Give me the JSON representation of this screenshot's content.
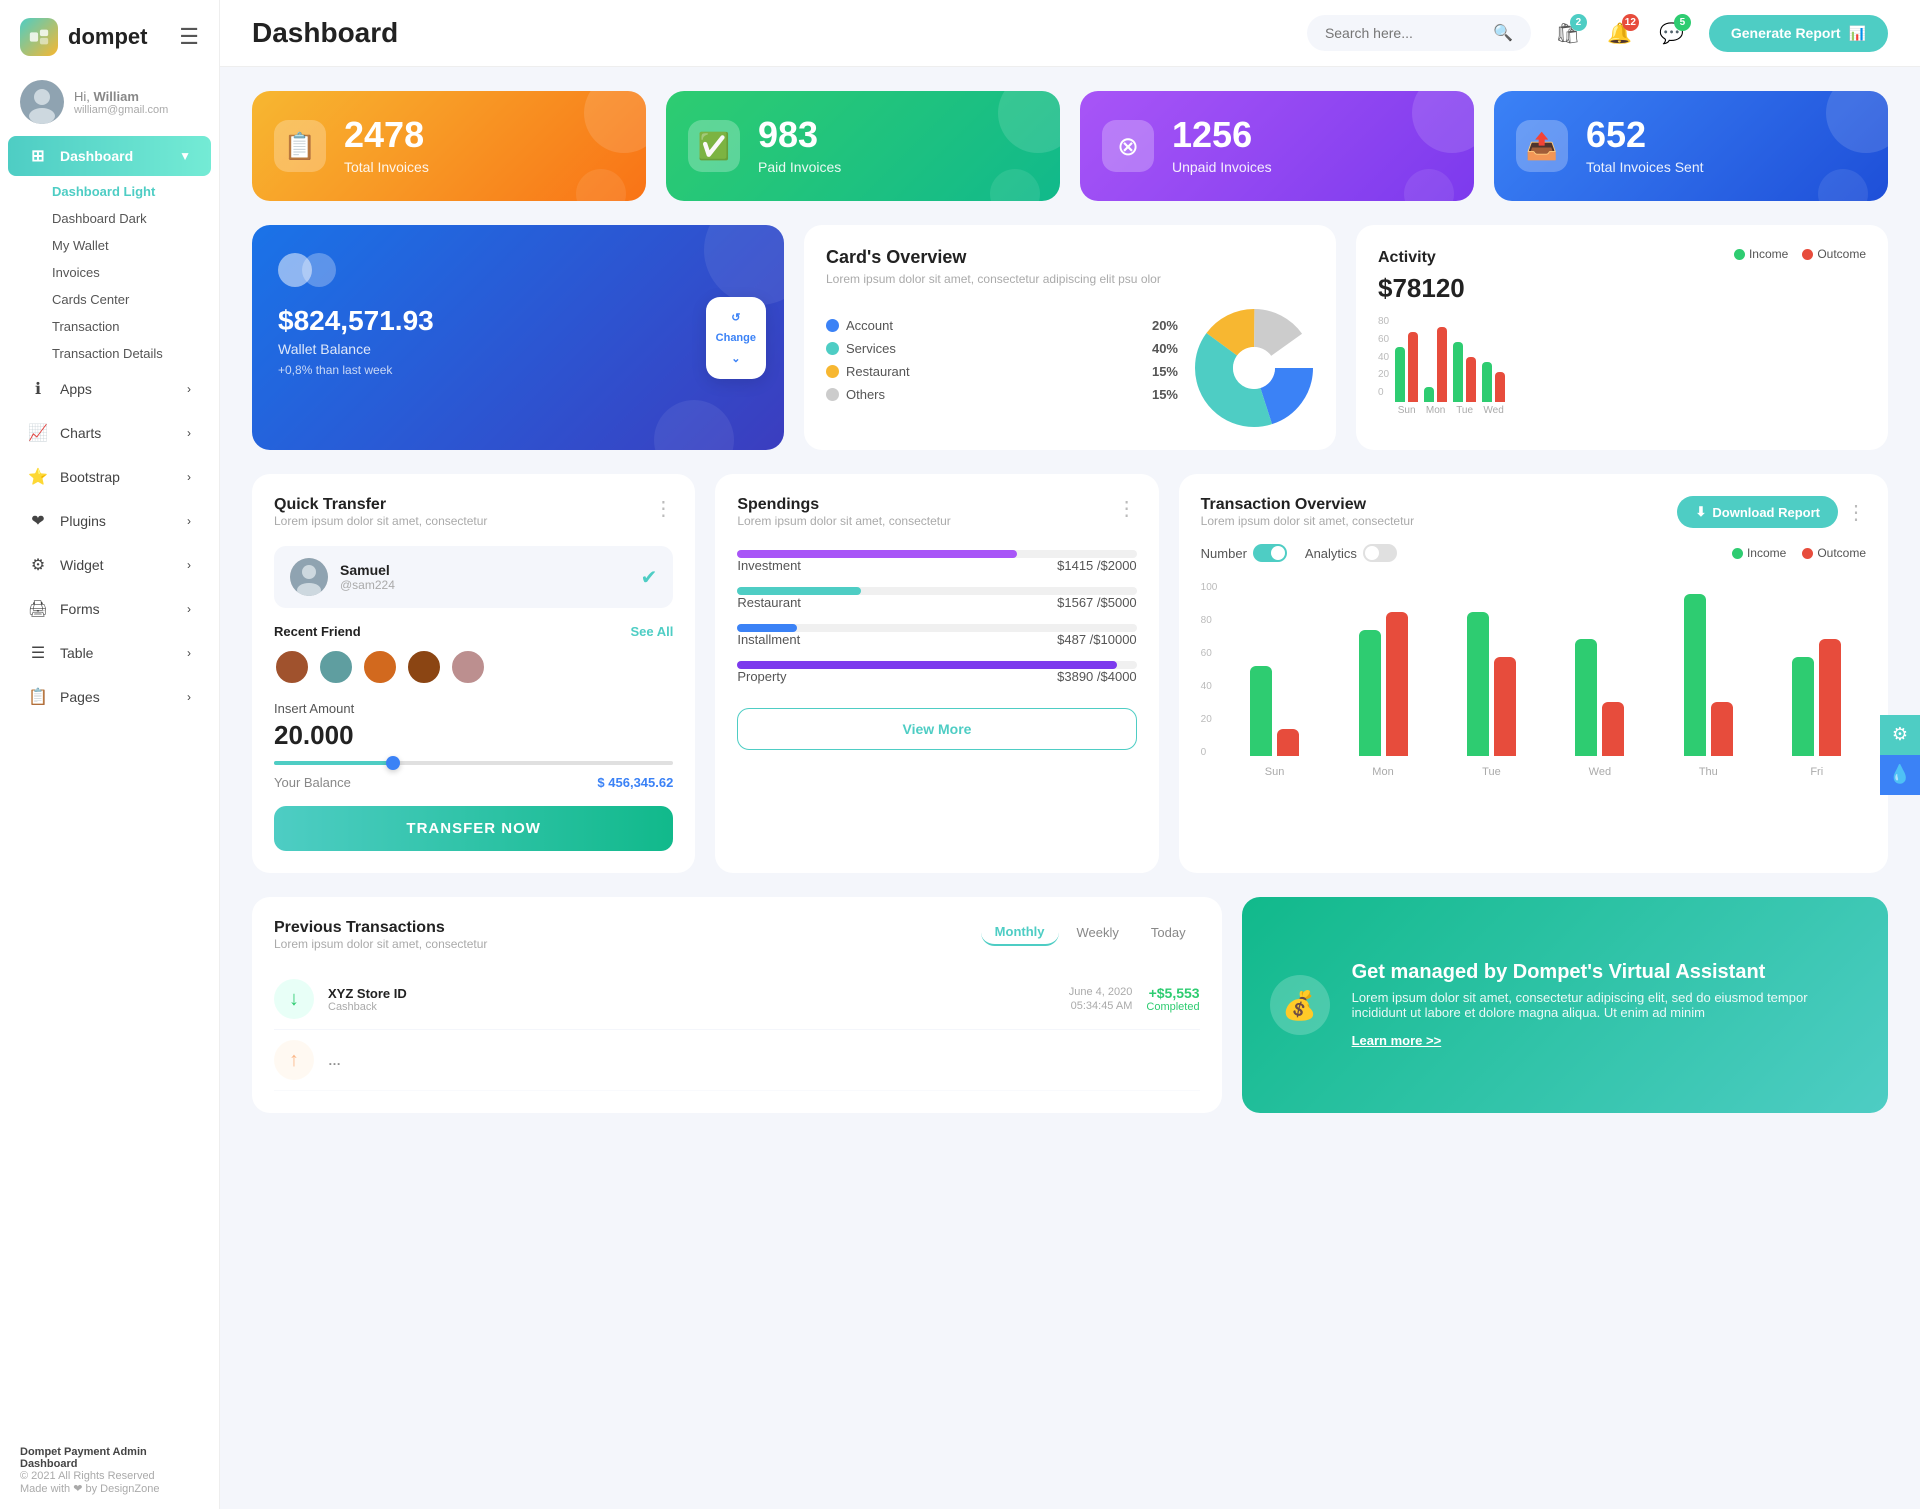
{
  "app": {
    "logo": "dompet",
    "title": "Dashboard"
  },
  "header": {
    "search_placeholder": "Search here...",
    "generate_btn": "Generate Report",
    "badges": {
      "cart": "2",
      "bell": "12",
      "chat": "5"
    }
  },
  "user": {
    "hi": "Hi,",
    "name": "William",
    "email": "william@gmail.com"
  },
  "sidebar": {
    "dashboard": "Dashboard",
    "sub_items": [
      {
        "label": "Dashboard Light",
        "active": true
      },
      {
        "label": "Dashboard Dark",
        "active": false
      },
      {
        "label": "My Wallet",
        "active": false
      },
      {
        "label": "Invoices",
        "active": false
      },
      {
        "label": "Cards Center",
        "active": false
      },
      {
        "label": "Transaction",
        "active": false
      },
      {
        "label": "Transaction Details",
        "active": false
      }
    ],
    "nav_items": [
      {
        "label": "Apps",
        "icon": "ℹ"
      },
      {
        "label": "Charts",
        "icon": "📈"
      },
      {
        "label": "Bootstrap",
        "icon": "⭐"
      },
      {
        "label": "Plugins",
        "icon": "❤"
      },
      {
        "label": "Widget",
        "icon": "⚙"
      },
      {
        "label": "Forms",
        "icon": "🖨"
      },
      {
        "label": "Table",
        "icon": "☰"
      },
      {
        "label": "Pages",
        "icon": "📋"
      }
    ],
    "footer": {
      "brand": "Dompet Payment Admin Dashboard",
      "copy": "© 2021 All Rights Reserved",
      "made_with": "Made with ❤ by DesignZone"
    }
  },
  "stat_cards": [
    {
      "number": "2478",
      "label": "Total Invoices",
      "color": "orange",
      "icon": "📋"
    },
    {
      "number": "983",
      "label": "Paid Invoices",
      "color": "green",
      "icon": "✅"
    },
    {
      "number": "1256",
      "label": "Unpaid Invoices",
      "color": "purple",
      "icon": "❌"
    },
    {
      "number": "652",
      "label": "Total Invoices Sent",
      "color": "blue",
      "icon": "📤"
    }
  ],
  "wallet": {
    "amount": "$824,571.93",
    "label": "Wallet Balance",
    "growth": "+0,8% than last week",
    "change_btn": "Change"
  },
  "cards_overview": {
    "title": "Card's Overview",
    "desc": "Lorem ipsum dolor sit amet, consectetur adipiscing elit psu olor",
    "items": [
      {
        "label": "Account",
        "pct": "20%",
        "color": "#3b82f6"
      },
      {
        "label": "Services",
        "pct": "40%",
        "color": "#4ecdc4"
      },
      {
        "label": "Restaurant",
        "pct": "15%",
        "color": "#f7b731"
      },
      {
        "label": "Others",
        "pct": "15%",
        "color": "#ccc"
      }
    ]
  },
  "activity": {
    "title": "Activity",
    "amount": "$78120",
    "legend": [
      {
        "label": "Income",
        "color": "#2ecc71"
      },
      {
        "label": "Outcome",
        "color": "#e74c3c"
      }
    ],
    "bars": [
      {
        "day": "Sun",
        "income": 55,
        "outcome": 70
      },
      {
        "day": "Mon",
        "income": 15,
        "outcome": 75
      },
      {
        "day": "Tue",
        "income": 60,
        "outcome": 45
      },
      {
        "day": "Wed",
        "income": 40,
        "outcome": 30
      }
    ]
  },
  "quick_transfer": {
    "title": "Quick Transfer",
    "desc": "Lorem ipsum dolor sit amet, consectetur",
    "recipient": {
      "name": "Samuel",
      "handle": "@sam224"
    },
    "recent_label": "Recent Friend",
    "see_all": "See All",
    "insert_label": "Insert Amount",
    "amount": "20.000",
    "balance_label": "Your Balance",
    "balance_value": "$ 456,345.62",
    "transfer_btn": "TRANSFER NOW"
  },
  "spendings": {
    "title": "Spendings",
    "desc": "Lorem ipsum dolor sit amet, consectetur",
    "items": [
      {
        "label": "Investment",
        "amount": "$1415",
        "max": "$2000",
        "pct": 70,
        "color": "#a855f7"
      },
      {
        "label": "Restaurant",
        "amount": "$1567",
        "max": "$5000",
        "pct": 31,
        "color": "#4ecdc4"
      },
      {
        "label": "Installment",
        "amount": "$487",
        "max": "$10000",
        "pct": 15,
        "color": "#3b82f6"
      },
      {
        "label": "Property",
        "amount": "$3890",
        "max": "$4000",
        "pct": 95,
        "color": "#7c3aed"
      }
    ],
    "view_more_btn": "View More"
  },
  "tx_overview": {
    "title": "Transaction Overview",
    "desc": "Lorem ipsum dolor sit amet, consectetur",
    "download_btn": "Download Report",
    "toggle_number": "Number",
    "toggle_analytics": "Analytics",
    "legend": [
      {
        "label": "Income",
        "color": "#2ecc71"
      },
      {
        "label": "Outcome",
        "color": "#e74c3c"
      }
    ],
    "bars": [
      {
        "day": "Sun",
        "income": 50,
        "outcome": 15
      },
      {
        "day": "Mon",
        "income": 70,
        "outcome": 80
      },
      {
        "day": "Tue",
        "income": 80,
        "outcome": 55
      },
      {
        "day": "Wed",
        "income": 65,
        "outcome": 30
      },
      {
        "day": "Thu",
        "income": 90,
        "outcome": 30
      },
      {
        "day": "Fri",
        "income": 55,
        "outcome": 65
      }
    ],
    "y_labels": [
      "100",
      "80",
      "60",
      "40",
      "20",
      "0"
    ]
  },
  "prev_transactions": {
    "title": "Previous Transactions",
    "desc": "Lorem ipsum dolor sit amet, consectetur",
    "tabs": [
      "Monthly",
      "Weekly",
      "Today"
    ],
    "active_tab": "Monthly",
    "items": [
      {
        "name": "XYZ Store ID",
        "type": "Cashback",
        "date": "June 4, 2020",
        "time": "05:34:45 AM",
        "amount": "+$5,553",
        "status": "Completed",
        "positive": true,
        "icon": "↓"
      }
    ]
  },
  "va_banner": {
    "title": "Get managed by Dompet's Virtual Assistant",
    "desc": "Lorem ipsum dolor sit amet, consectetur adipiscing elit, sed do eiusmod tempor incididunt ut labore et dolore magna aliqua. Ut enim ad minim",
    "link": "Learn more >>"
  }
}
